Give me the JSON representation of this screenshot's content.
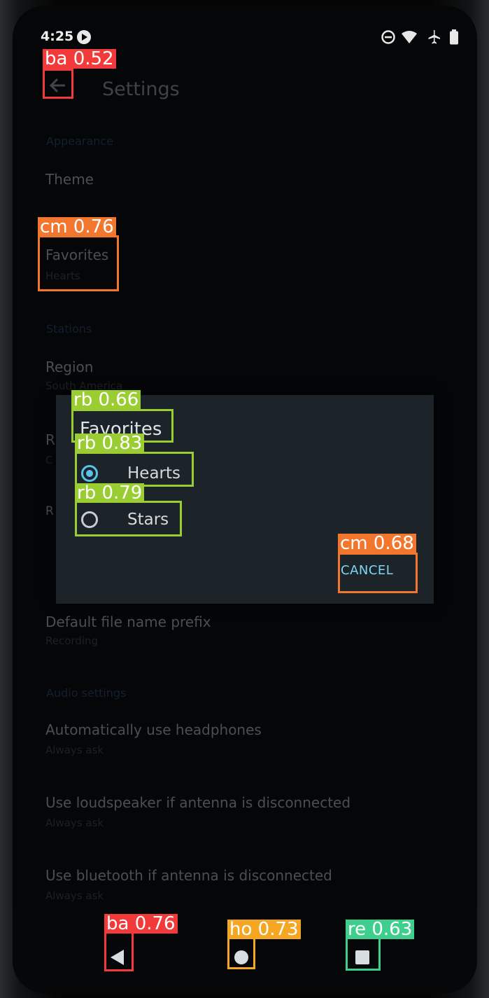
{
  "status_bar": {
    "time": "4:25"
  },
  "app_bar": {
    "title": "Settings"
  },
  "settings": {
    "appearance_header": "Appearance",
    "theme": {
      "title": "Theme",
      "summary": ""
    },
    "favorites": {
      "title": "Favorites",
      "summary": "Hearts"
    },
    "stations_header": "Stations",
    "region": {
      "title": "Region",
      "summary": "South America"
    },
    "row_r1": {
      "title": "R",
      "summary": "C"
    },
    "row_r2": {
      "title": "R"
    },
    "default_prefix": {
      "title": "Default file name prefix",
      "summary": "Recording"
    },
    "audio_header": "Audio settings",
    "headphones": {
      "title": "Automatically use headphones",
      "summary": "Always ask"
    },
    "loudspeaker": {
      "title": "Use loudspeaker if antenna is disconnected",
      "summary": "Always ask"
    },
    "bluetooth": {
      "title": "Use bluetooth if antenna is disconnected",
      "summary": "Always ask"
    }
  },
  "dialog": {
    "title": "Favorites",
    "options": [
      {
        "label": "Hearts",
        "selected": true
      },
      {
        "label": "Stars",
        "selected": false
      }
    ],
    "cancel_label": "CANCEL"
  },
  "detections": [
    {
      "label": "ba 0.52",
      "color": "#f23a3a"
    },
    {
      "label": "cm 0.76",
      "color": "#f2762e"
    },
    {
      "label": "rb 0.66",
      "color": "#9acd32"
    },
    {
      "label": "rb 0.83",
      "color": "#9acd32"
    },
    {
      "label": "rb 0.79",
      "color": "#9acd32"
    },
    {
      "label": "cm 0.68",
      "color": "#f2762e"
    },
    {
      "label": "ba 0.76",
      "color": "#f23a3a"
    },
    {
      "label": "ho 0.73",
      "color": "#f5a623"
    },
    {
      "label": "re 0.63",
      "color": "#3ecf8e"
    }
  ]
}
